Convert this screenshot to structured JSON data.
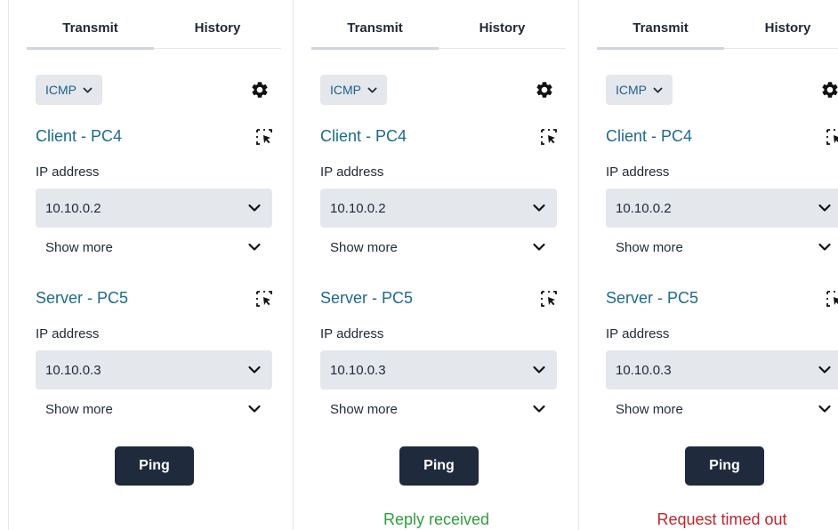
{
  "colors": {
    "reply_received": "#2e9e3e",
    "request_timed_out": "#c0262d",
    "accent_title": "#1d6a8a",
    "field_bg": "#e4e7ec",
    "ping_bg": "#1f2a3c"
  },
  "icons": {
    "settings": "gear-icon",
    "selector": "select-target-icon",
    "dropdown": "chevron-down-icon"
  },
  "panels": [
    {
      "tabs": {
        "transmit": "Transmit",
        "history": "History"
      },
      "protocol": "ICMP",
      "client": {
        "title": "Client - PC4",
        "ip_label": "IP address",
        "ip_value": "10.10.0.2",
        "show_more": "Show more"
      },
      "server": {
        "title": "Server - PC5",
        "ip_label": "IP address",
        "ip_value": "10.10.0.3",
        "show_more": "Show more"
      },
      "ping_label": "Ping",
      "status": ""
    },
    {
      "tabs": {
        "transmit": "Transmit",
        "history": "History"
      },
      "protocol": "ICMP",
      "client": {
        "title": "Client - PC4",
        "ip_label": "IP address",
        "ip_value": "10.10.0.2",
        "show_more": "Show more"
      },
      "server": {
        "title": "Server - PC5",
        "ip_label": "IP address",
        "ip_value": "10.10.0.3",
        "show_more": "Show more"
      },
      "ping_label": "Ping",
      "status": "Reply received"
    },
    {
      "tabs": {
        "transmit": "Transmit",
        "history": "History"
      },
      "protocol": "ICMP",
      "client": {
        "title": "Client - PC4",
        "ip_label": "IP address",
        "ip_value": "10.10.0.2",
        "show_more": "Show more"
      },
      "server": {
        "title": "Server - PC5",
        "ip_label": "IP address",
        "ip_value": "10.10.0.3",
        "show_more": "Show more"
      },
      "ping_label": "Ping",
      "status": "Request timed out"
    }
  ]
}
